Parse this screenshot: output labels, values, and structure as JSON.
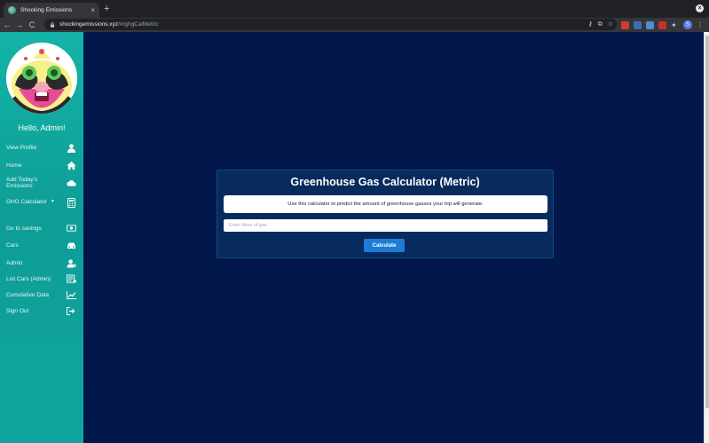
{
  "browser": {
    "tab_title": "Shocking Emissions",
    "tab_close": "×",
    "new_tab": "+",
    "url_host": "shockingemissions.xyz",
    "url_path": "/#/ghgCalMetric",
    "profile_initial": "S",
    "nav_back": "←",
    "nav_forward": "→",
    "nav_reload": "C",
    "window_close": "×",
    "menu": "⋮"
  },
  "sidebar": {
    "greeting": "Hello, Admin!",
    "items": [
      {
        "label": "View Profile",
        "icon": "user-icon"
      },
      {
        "label": "Home",
        "icon": "home-icon"
      },
      {
        "label": "Add Today's Emissions",
        "icon": "cloud-icon"
      },
      {
        "label": "GHG Calculator",
        "icon": "calculator-icon"
      },
      {
        "label": "Go to savings",
        "icon": "money-icon"
      },
      {
        "label": "Cars",
        "icon": "car-icon"
      },
      {
        "label": "Admin",
        "icon": "user-cog-icon"
      },
      {
        "label": "List Cars (Admin)",
        "icon": "list-icon"
      },
      {
        "label": "Cumulative Data",
        "icon": "chart-icon"
      },
      {
        "label": "Sign Out",
        "icon": "sign-out-icon"
      }
    ]
  },
  "calculator": {
    "title": "Greenhouse Gas Calculator (Metric)",
    "description": "Use this calculator to predict the amount of greenhouse gasses your trip will generate.",
    "input_placeholder": "Enter liters of gas",
    "button_label": "Calculate"
  },
  "colors": {
    "sidebar": "#11a5a0",
    "main_bg": "#02174a",
    "card_bg": "#062b5c",
    "button": "#1e7bd6"
  }
}
